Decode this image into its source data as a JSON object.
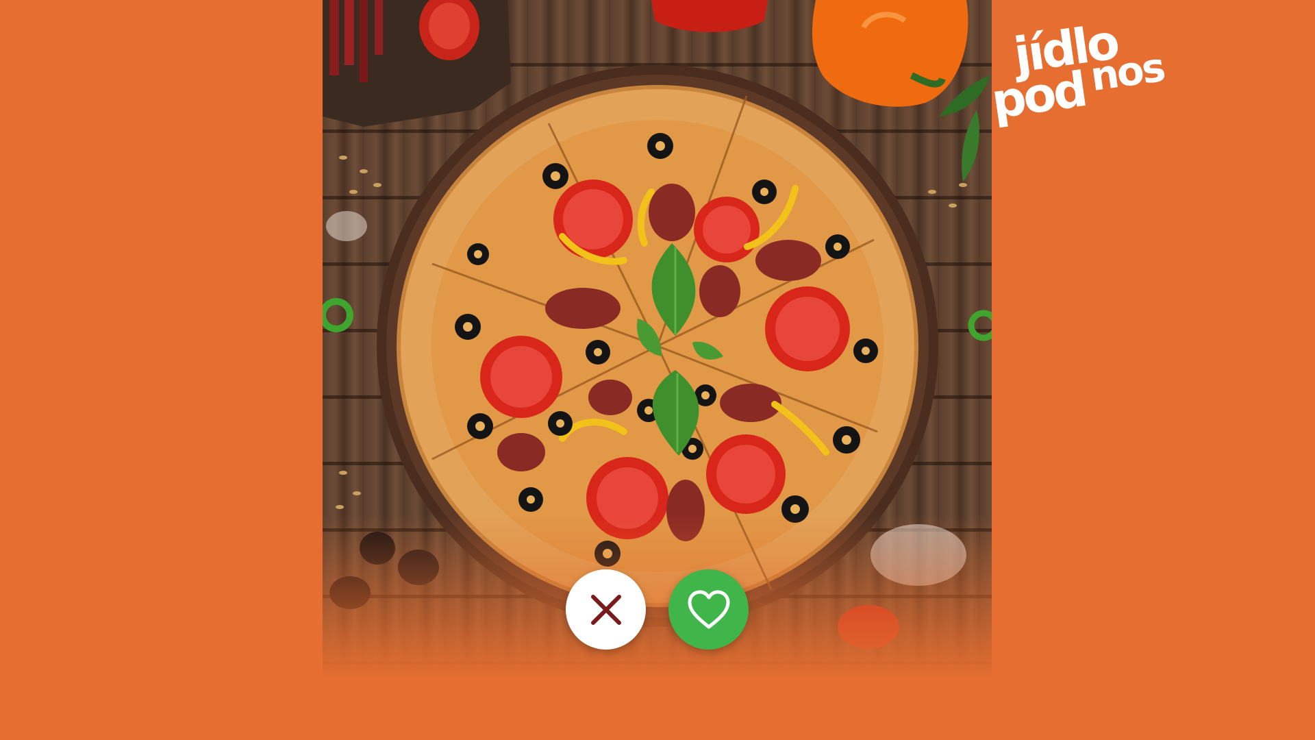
{
  "brand": {
    "logo_line1": "jídlo",
    "logo_line2_a": "pod",
    "logo_line2_b": "nos"
  },
  "colors": {
    "background": "#E56E30",
    "like_button": "#3FB54A",
    "reject_button": "#FFFFFF",
    "reject_icon": "#7A1A1A",
    "logo": "#FFFFFF"
  },
  "card": {
    "image": "pizza-photo"
  },
  "actions": {
    "reject_icon": "close-icon",
    "like_icon": "heart-icon"
  }
}
